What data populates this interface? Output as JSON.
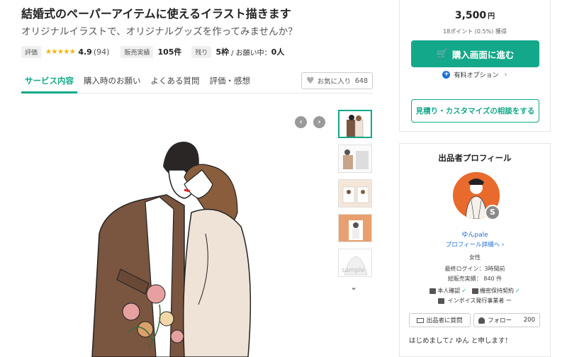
{
  "service": {
    "title": "結婚式のペーパーアイテムに使えるイラスト描きます",
    "subtitle": "オリジナルイラストで、オリジナルグッズを作ってみませんか？"
  },
  "stats": {
    "rating_tag": "評価",
    "stars": "★★★★★",
    "rating_value": "4.9",
    "rating_count": "(94)",
    "sales_tag": "販売実績",
    "sales_value": "105件",
    "remaining_tag": "残り",
    "remaining_value": "5枠",
    "inquiry_label": "/ お願い中：",
    "inquiry_value": "0人"
  },
  "tabs": [
    {
      "label": "サービス内容",
      "active": true
    },
    {
      "label": "購入時のお願い",
      "active": false
    },
    {
      "label": "よくある質問",
      "active": false
    },
    {
      "label": "評価・感想",
      "active": false
    }
  ],
  "favorite": {
    "label": "お気に入り",
    "count": "648"
  },
  "price_card": {
    "price": "3,500",
    "currency": "円",
    "points": "18ポイント (0.5%) 獲得",
    "buy_label": "購入画面に進む",
    "options_label": "有料オプション",
    "consult_label": "見積り・カスタマイズの相談をする"
  },
  "profile": {
    "heading": "出品者プロフィール",
    "badge": "S",
    "name": "ゆんpale",
    "detail_link": "プロフィール詳細へ",
    "gender": "女性",
    "last_login": "最終ログイン：3時間前",
    "total_sales": "総販売実績： 840 件",
    "identity": "本人確認",
    "nda": "機密保持契約",
    "invoice": "インボイス発行事業者 ー",
    "message_label": "出品者に質問",
    "follow_label": "フォロー",
    "follow_count": "200",
    "intro": "はじめまして♪ ゆん と申します！"
  },
  "colors": {
    "accent": "#14a88a",
    "link": "#1b6fd1",
    "star": "#f6b100",
    "jacket": "#7a5540",
    "dress": "#efe3d8",
    "avatar_bg": "#e86a2c"
  },
  "icons": [
    "heart-icon",
    "cart-icon",
    "plus-circle-icon",
    "chevron-right-icon",
    "chevron-left-icon",
    "chevron-down-icon",
    "id-card-icon",
    "envelope-icon",
    "user-plus-icon",
    "check-icon"
  ]
}
